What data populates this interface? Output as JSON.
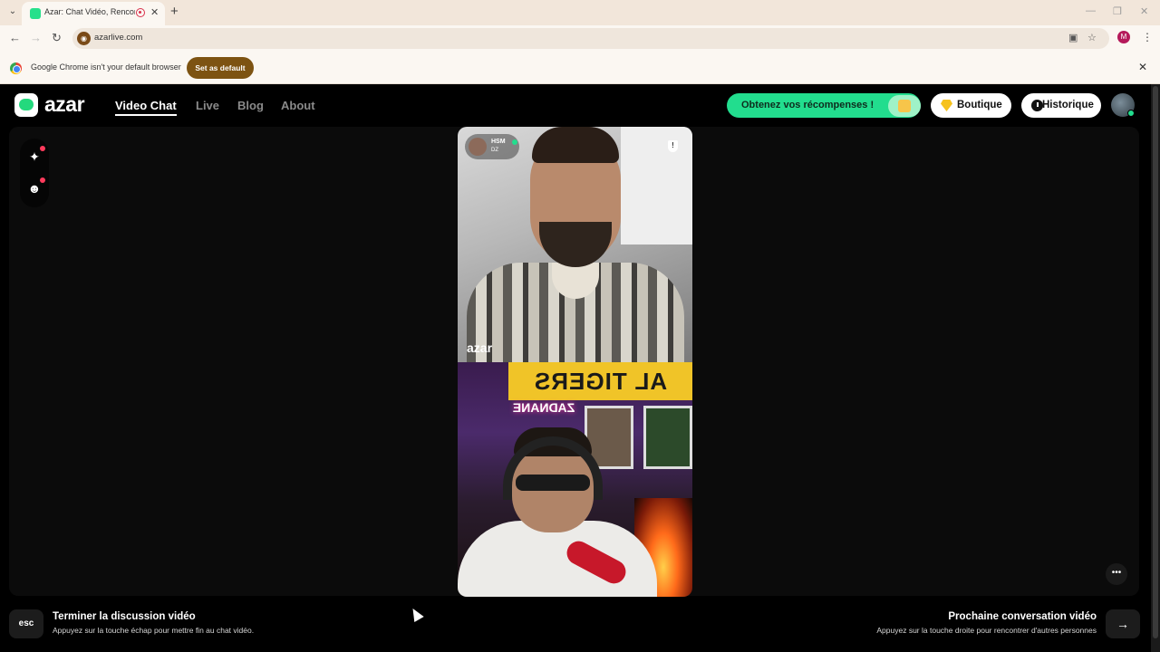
{
  "browser": {
    "tab_title": "Azar: Chat Vidéo, Rencontr",
    "url": "azarlive.com",
    "profile_initial": "M",
    "infobar_text": "Google Chrome isn't your default browser",
    "set_default_label": "Set as default"
  },
  "header": {
    "logo_text": "azar",
    "nav": [
      {
        "label": "Video Chat",
        "active": true
      },
      {
        "label": "Live",
        "active": false
      },
      {
        "label": "Blog",
        "active": false
      },
      {
        "label": "About",
        "active": false
      }
    ],
    "rewards_label": "Obtenez vos récompenses !",
    "shop_label": "Boutique",
    "history_label": "Historique"
  },
  "video": {
    "caller_name": "HSM",
    "caller_country": "DZ",
    "watermark": "azar",
    "top_banner_text": "AL TIGERS",
    "neon_text": "ZADNANE"
  },
  "footer": {
    "esc_key": "esc",
    "end_title": "Terminer la discussion vidéo",
    "end_subtitle": "Appuyez sur la touche échap pour mettre fin au chat vidéo.",
    "next_title": "Prochaine conversation vidéo",
    "next_subtitle": "Appuyez sur la touche droite pour rencontrer d'autres personnes"
  },
  "colors": {
    "brand_green": "#22dd8e",
    "page_bg": "#000000",
    "chrome_accent": "#7d5312"
  }
}
